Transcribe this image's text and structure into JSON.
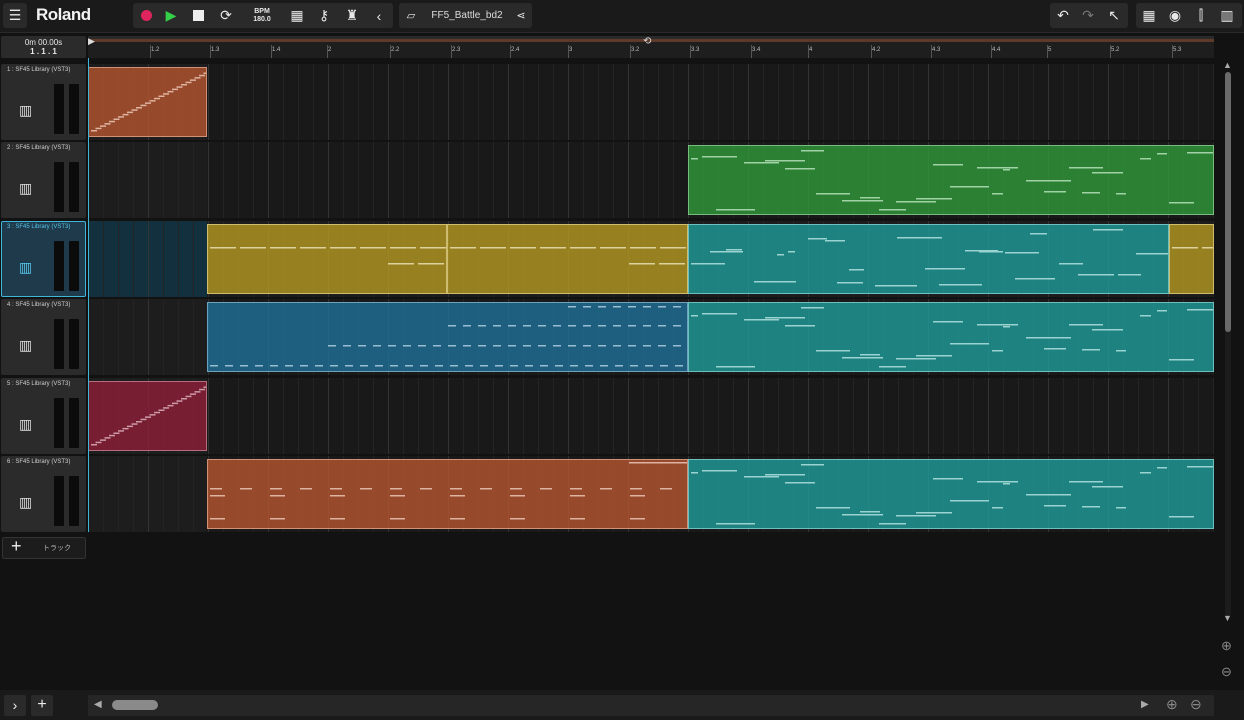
{
  "header": {
    "logo": "Roland",
    "bpm_label": "BPM",
    "bpm_value": "180.0",
    "project_name": "FF5_Battle_bd2"
  },
  "transport": {
    "time": "0m 00.00s",
    "position": "1 . 1 . 1"
  },
  "ruler": {
    "ticks": [
      "1.2",
      "1.3",
      "1.4",
      "2",
      "2.2",
      "2.3",
      "2.4",
      "3",
      "3.2",
      "3.3",
      "3.4",
      "4",
      "4.2",
      "4.3",
      "4.4",
      "5",
      "5.2",
      "5.3"
    ]
  },
  "tracks": [
    {
      "name": "1 : SF45 Library (VST3)",
      "selected": false
    },
    {
      "name": "2 : SF45 Library (VST3)",
      "selected": false
    },
    {
      "name": "3 : SF45 Library (VST3)",
      "selected": true
    },
    {
      "name": "4 : SF45 Library (VST3)",
      "selected": false
    },
    {
      "name": "5 : SF45 Library (VST3)",
      "selected": false
    },
    {
      "name": "6 : SF45 Library (VST3)",
      "selected": false
    }
  ],
  "add_track_label": "トラック",
  "clip_colors": {
    "orange": "#b5562f",
    "green": "#2f9a3a",
    "yellow": "#b59a22",
    "teal": "#1f9e9a",
    "blue": "#1f6f99",
    "crimson": "#8e1f3a"
  },
  "icons": [
    "menu-icon",
    "record-icon",
    "play-icon",
    "stop-icon",
    "loop-icon",
    "grid-icon",
    "key-icon",
    "metronome-icon",
    "back-icon",
    "folder-icon",
    "share-icon",
    "undo-icon",
    "redo-icon",
    "pointer-icon",
    "mixer-icon",
    "eye-icon",
    "faders-icon",
    "keyboard-icon"
  ]
}
